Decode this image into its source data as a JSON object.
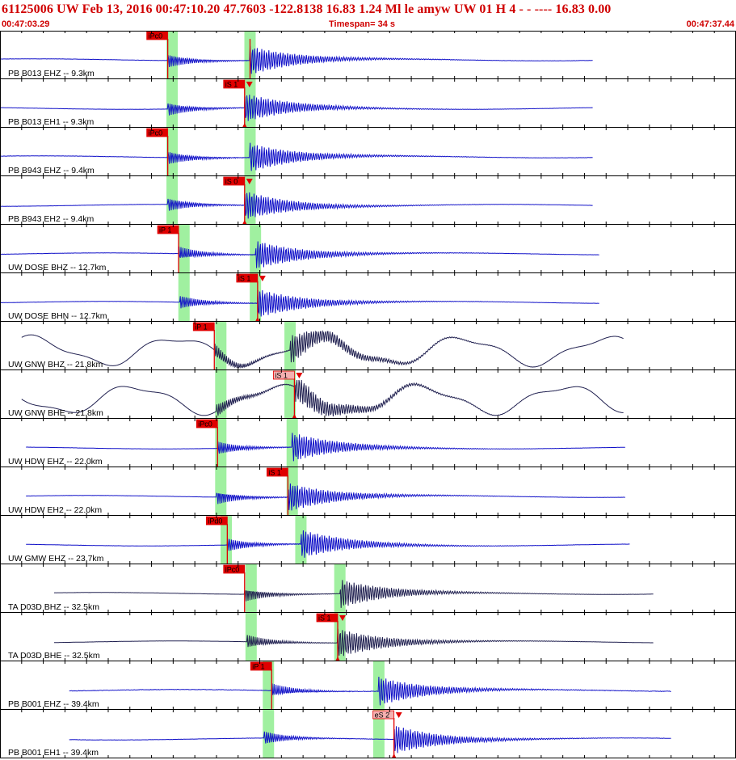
{
  "header": {
    "title": "61125006 UW Feb 13, 2016 00:47:10.20    47.7603 -122.8138 16.83 1.24 Ml le     amyw     UW 01 H    4  -  - ---- 16.83 0.00",
    "start_time": "00:47:03.29",
    "timespan": "Timespan=  34 s",
    "end_time": "00:47:37.44"
  },
  "colors": {
    "trace_blue": "#1010c8",
    "trace_dark": "#202050",
    "pick_red": "#e00000",
    "pick_label_light": "#f4b0b0",
    "green_band": "#a0f0a0",
    "header_red": "#d00000"
  },
  "chart_data": {
    "type": "seismogram",
    "x_start": "00:47:03.29",
    "x_end": "00:47:37.44",
    "timespan_s": 34,
    "traces": [
      {
        "label": "PB B013 EHZ -- 9.3km",
        "color": "blue",
        "lowfreq": false,
        "noise": 0.1,
        "trace_end_s": 27.4,
        "picks": [
          {
            "label": "iPc0",
            "t": 7.75,
            "type": "P",
            "style": "dark",
            "flag": false
          },
          {
            "label": "",
            "t": 11.55,
            "type": "S",
            "style": "none",
            "flag": false
          }
        ],
        "green": [
          7.95,
          11.55
        ]
      },
      {
        "label": "PB B013 EH1 -- 9.3km",
        "color": "blue",
        "lowfreq": false,
        "noise": 0.07,
        "trace_end_s": 27.4,
        "picks": [
          {
            "label": "iS 1",
            "t": 11.3,
            "type": "S",
            "style": "dark",
            "flag": true
          }
        ],
        "green": [
          7.95,
          11.55
        ]
      },
      {
        "label": "PB B943 EHZ -- 9.4km",
        "color": "blue",
        "lowfreq": false,
        "noise": 0.11,
        "trace_end_s": 27.4,
        "picks": [
          {
            "label": "iPc0",
            "t": 7.75,
            "type": "P",
            "style": "dark",
            "flag": false
          }
        ],
        "green": [
          7.95,
          11.55
        ]
      },
      {
        "label": "PB B943 EH2 -- 9.4km",
        "color": "blue",
        "lowfreq": false,
        "noise": 0.07,
        "trace_end_s": 27.4,
        "picks": [
          {
            "label": "iS 0",
            "t": 11.3,
            "type": "S",
            "style": "dark",
            "flag": true
          }
        ],
        "green": [
          7.95,
          11.55
        ]
      },
      {
        "label": "UW DOSE BHZ -- 12.7km",
        "color": "blue",
        "lowfreq": false,
        "noise": 0.09,
        "trace_end_s": 27.7,
        "picks": [
          {
            "label": "iP 1",
            "t": 8.25,
            "type": "P",
            "style": "dark",
            "flag": false
          }
        ],
        "green": [
          8.5,
          11.8
        ]
      },
      {
        "label": "UW DOSE BHN -- 12.7km",
        "color": "blue",
        "lowfreq": false,
        "noise": 0.06,
        "trace_end_s": 27.7,
        "picks": [
          {
            "label": "iS 1",
            "t": 11.9,
            "type": "S",
            "style": "dark",
            "flag": true
          }
        ],
        "green": [
          8.5,
          11.8
        ]
      },
      {
        "label": "UW GNW BHZ -- 21.8km",
        "color": "dark",
        "lowfreq": true,
        "noise": 0.0,
        "trace_end_s": 28.8,
        "picks": [
          {
            "label": "iP 1",
            "t": 9.9,
            "type": "P",
            "style": "dark",
            "flag": false
          }
        ],
        "green": [
          10.2,
          13.4
        ]
      },
      {
        "label": "UW GNW BHE -- 21.8km",
        "color": "dark",
        "lowfreq": true,
        "noise": 0.0,
        "trace_end_s": 28.8,
        "picks": [
          {
            "label": "iS 1",
            "t": 13.6,
            "type": "S",
            "style": "light",
            "flag": true
          }
        ],
        "green": [
          10.2,
          13.4
        ]
      },
      {
        "label": "UW HDW EHZ -- 22.0km",
        "color": "blue",
        "lowfreq": false,
        "noise": 0.05,
        "trace_end_s": 28.9,
        "picks": [
          {
            "label": "iPc0",
            "t": 10.05,
            "type": "P",
            "style": "dark",
            "flag": false
          }
        ],
        "green": [
          10.2,
          13.5
        ]
      },
      {
        "label": "UW HDW EH2 -- 22.0km",
        "color": "blue",
        "lowfreq": false,
        "noise": 0.05,
        "trace_end_s": 28.9,
        "picks": [
          {
            "label": "iS 1",
            "t": 13.3,
            "type": "S",
            "style": "dark",
            "flag": false
          }
        ],
        "green": [
          10.2,
          13.5
        ]
      },
      {
        "label": "UW GMW EHZ -- 23.7km",
        "color": "blue",
        "lowfreq": false,
        "noise": 0.07,
        "trace_end_s": 29.1,
        "picks": [
          {
            "label": "iPd0",
            "t": 10.5,
            "type": "P",
            "style": "dark",
            "flag": false
          }
        ],
        "green": [
          10.45,
          13.9
        ]
      },
      {
        "label": "TA D03D BHZ -- 32.5km",
        "color": "dark",
        "lowfreq": false,
        "noise": 0.05,
        "trace_end_s": 30.2,
        "picks": [
          {
            "label": "iPc0",
            "t": 11.3,
            "type": "P",
            "style": "dark",
            "flag": false
          }
        ],
        "green": [
          11.6,
          15.7
        ]
      },
      {
        "label": "TA D03D BHE -- 32.5km",
        "color": "dark",
        "lowfreq": false,
        "noise": 0.03,
        "trace_end_s": 30.2,
        "picks": [
          {
            "label": "iS 1",
            "t": 15.6,
            "type": "S",
            "style": "dark",
            "flag": true
          }
        ],
        "green": [
          11.6,
          15.7
        ]
      },
      {
        "label": "PB B001 EHZ -- 39.4km",
        "color": "blue",
        "lowfreq": false,
        "noise": 0.18,
        "trace_end_s": 31.0,
        "picks": [
          {
            "label": "iP 1",
            "t": 12.55,
            "type": "P",
            "style": "dark",
            "flag": false
          }
        ],
        "green": [
          12.4,
          17.5
        ]
      },
      {
        "label": "PB B001 EH1 -- 39.4km",
        "color": "blue",
        "lowfreq": false,
        "noise": 0.1,
        "trace_end_s": 31.0,
        "picks": [
          {
            "label": "eS 2",
            "t": 18.2,
            "type": "S",
            "style": "light",
            "flag": true
          }
        ],
        "green": [
          12.4,
          17.5
        ]
      }
    ]
  }
}
